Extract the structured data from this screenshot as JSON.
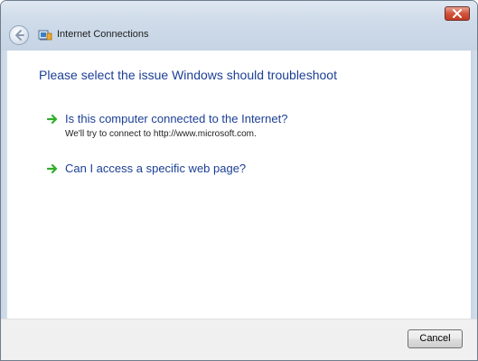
{
  "window": {
    "title": "Internet Connections"
  },
  "main": {
    "heading": "Please select the issue Windows should troubleshoot",
    "options": [
      {
        "title": "Is this computer connected to the Internet?",
        "description": "We'll try to connect to http://www.microsoft.com."
      },
      {
        "title": "Can I access a specific web page?",
        "description": ""
      }
    ]
  },
  "footer": {
    "cancel_label": "Cancel"
  },
  "colors": {
    "heading": "#1c3f95",
    "arrow_green": "#2fae2a",
    "close_red": "#c23a22"
  }
}
